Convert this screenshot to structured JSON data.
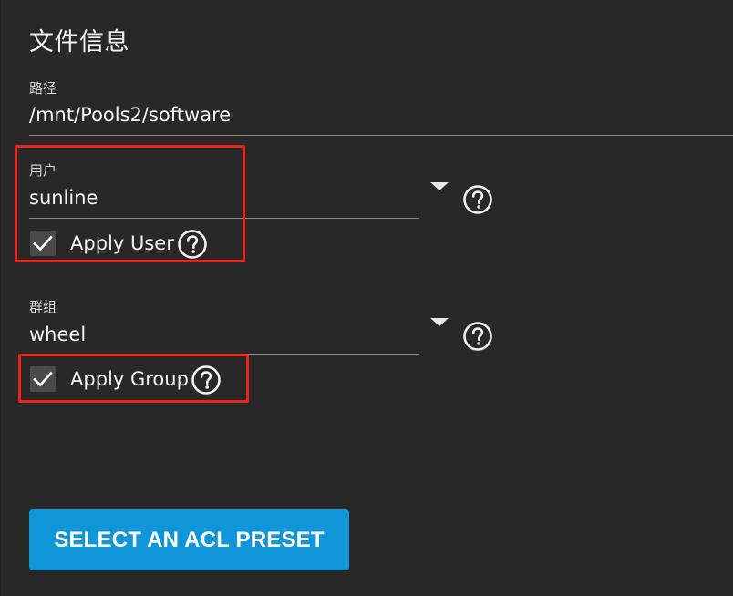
{
  "section": {
    "title": "文件信息"
  },
  "path": {
    "label": "路径",
    "value": "/mnt/Pools2/software"
  },
  "user": {
    "label": "用户",
    "value": "sunline",
    "apply_label": "Apply User",
    "apply_checked": true
  },
  "group": {
    "label": "群组",
    "value": "wheel",
    "apply_label": "Apply Group",
    "apply_checked": true
  },
  "actions": {
    "preset_button": "SELECT AN ACL PRESET"
  },
  "colors": {
    "background": "#282828",
    "accent": "#0f95d8",
    "highlight": "#e8241c"
  }
}
